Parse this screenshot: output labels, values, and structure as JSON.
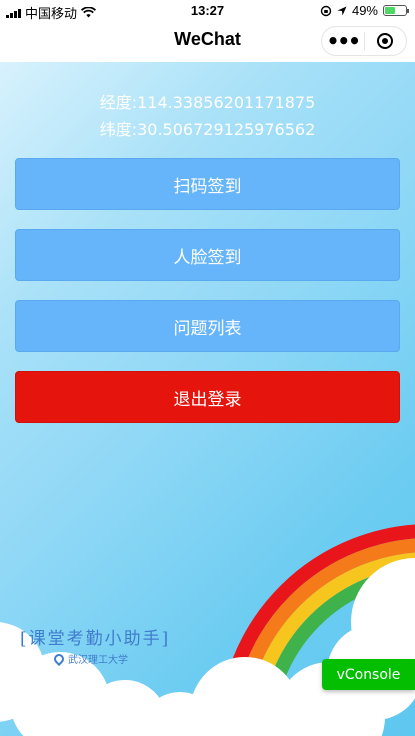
{
  "status_bar": {
    "carrier": "中国移动",
    "time": "13:27",
    "battery": "49%",
    "battery_level": 0.49
  },
  "nav": {
    "title": "WeChat"
  },
  "coords": {
    "longitude": "经度:114.33856201171875",
    "latitude": "纬度:30.506729125976562"
  },
  "buttons": {
    "scan_checkin": "扫码签到",
    "face_checkin": "人脸签到",
    "question_list": "问题列表",
    "logout": "退出登录"
  },
  "logo": {
    "title": "[课堂考勤小助手]",
    "subtitle": "武汉理工大学"
  },
  "vconsole": "vConsole",
  "colors": {
    "button_blue": "#66b5fb",
    "button_red": "#e5140d",
    "vconsole_green": "#04be02"
  }
}
